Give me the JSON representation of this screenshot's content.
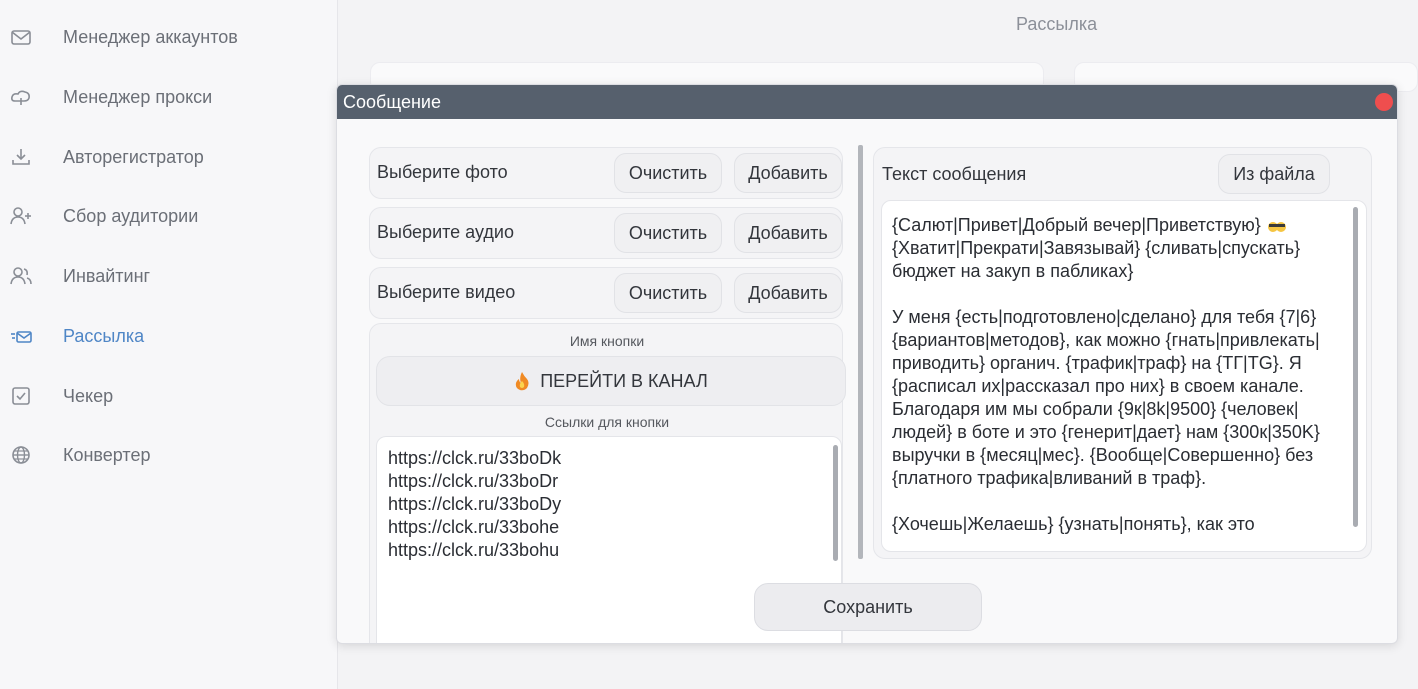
{
  "sidebar": {
    "items": [
      {
        "label": "Менеджер аккаунтов",
        "icon": "mail-icon"
      },
      {
        "label": "Менеджер прокси",
        "icon": "cloud-icon"
      },
      {
        "label": "Авторегистратор",
        "icon": "download-icon"
      },
      {
        "label": "Сбор аудитории",
        "icon": "add-user-icon"
      },
      {
        "label": "Инвайтинг",
        "icon": "users-icon"
      },
      {
        "label": "Рассылка",
        "icon": "send-mail-icon"
      },
      {
        "label": "Чекер",
        "icon": "check-square-icon"
      },
      {
        "label": "Конвертер",
        "icon": "globe-icon"
      }
    ],
    "active": "Рассылка"
  },
  "page": {
    "title": "Рассылка"
  },
  "modal": {
    "title": "Сообщение",
    "media_rows": [
      {
        "label": "Выберите фото",
        "clear": "Очистить",
        "add": "Добавить"
      },
      {
        "label": "Выберите аудио",
        "clear": "Очистить",
        "add": "Добавить"
      },
      {
        "label": "Выберите видео",
        "clear": "Очистить",
        "add": "Добавить"
      }
    ],
    "button_name_caption": "Имя кнопки",
    "button_name": "ПЕРЕЙТИ В КАНАЛ",
    "links_caption": "Ссылки для кнопки",
    "links": [
      "https://clck.ru/33boDk",
      "https://clck.ru/33boDr",
      "https://clck.ru/33boDy",
      "https://clck.ru/33bohe",
      "https://clck.ru/33bohu"
    ],
    "message_label": "Текст сообщения",
    "from_file": "Из файла",
    "message_lines": [
      "{Салют|Привет|Добрый вечер|Приветствую}",
      "{Хватит|Прекрати|Завязывай} {сливать|спускать}",
      "бюджет на закуп в пабликах}",
      "",
      "У меня {есть|подготовлено|сделано} для тебя {7|6}",
      "{вариантов|методов}, как можно {гнать|привлекать|",
      "приводить} органич. {трафик|траф} на {ТГ|TG}. Я",
      "{расписал их|рассказал про них} в своем канале.",
      "Благодаря им мы собрали {9к|8k|9500} {человек|",
      "людей} в боте и это {генерит|дает} нам {300к|350K}",
      "выручки в {месяц|мес}. {Вообще|Совершенно} без",
      "{платного трафика|вливаний в траф}.",
      "",
      "{Хочешь|Желаешь} {узнать|понять}, как это"
    ],
    "save": "Сохранить"
  },
  "colors": {
    "accent": "#4f86c6",
    "header": "#56606d",
    "close": "#ef4e4e"
  }
}
